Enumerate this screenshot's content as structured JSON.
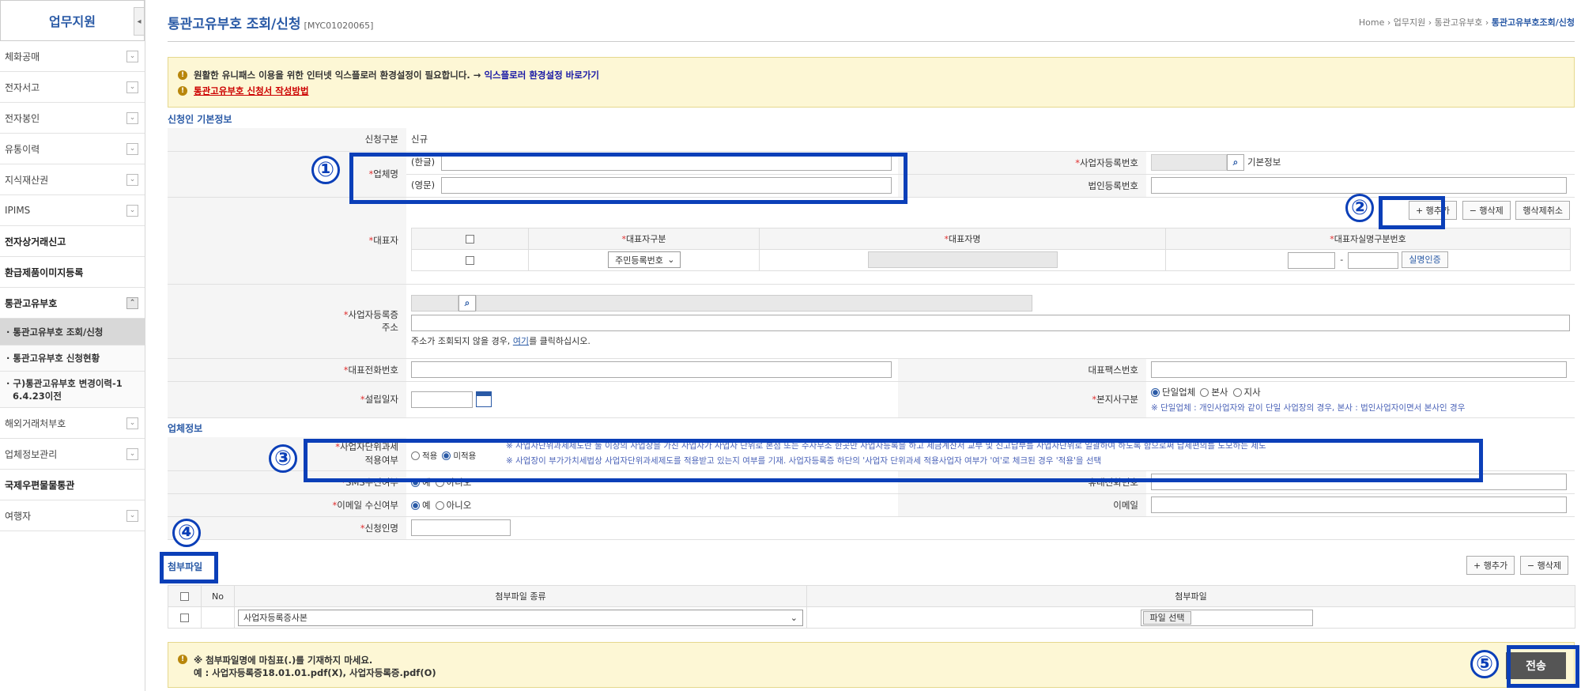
{
  "sidebar": {
    "title": "업무지원",
    "toggle": "◂",
    "items": [
      {
        "label": "체화공매"
      },
      {
        "label": "전자서고"
      },
      {
        "label": "전자봉인"
      },
      {
        "label": "유통이력"
      },
      {
        "label": "지식재산권"
      },
      {
        "label": "IPIMS"
      },
      {
        "label": "전자상거래신고"
      },
      {
        "label": "환급제품이미지등록"
      },
      {
        "label": "통관고유부호"
      }
    ],
    "sub_items": [
      {
        "label": "· 통관고유부호 조회/신청"
      },
      {
        "label": "· 통관고유부호 신청현황"
      },
      {
        "label_line1": "· 구)통관고유부호 변경이력-1",
        "label_line2": "6.4.23이전"
      }
    ],
    "items_after": [
      {
        "label": "해외거래처부호"
      },
      {
        "label": "업체정보관리"
      },
      {
        "label": "국제우편물물통관"
      },
      {
        "label": "여행자"
      }
    ]
  },
  "header": {
    "title": "통관고유부호 조회/신청",
    "code": "[MYC01020065]",
    "breadcrumb": [
      "Home",
      "업무지원",
      "통관고유부호",
      "통관고유부호조회/신청"
    ],
    "sep": "›"
  },
  "notice": {
    "line1_text": "원활한 유니패스 이용을 위한 인터넷 익스플로러 환경설정이 필요합니다. →",
    "line1_link": "익스플로러 환경설정 바로가기",
    "line2_link": "통관고유부호 신청서 작성방법"
  },
  "applicant": {
    "section_title": "신청인 기본정보",
    "apply_type_label": "신청구분",
    "apply_type_value": "신규",
    "company_name_label": "업체명",
    "company_kor_label": "(한글)",
    "company_eng_label": "(영문)",
    "biz_reg_no_label": "사업자등록번호",
    "basic_info": "기본정보",
    "corp_reg_no_label": "법인등록번호",
    "add_row": "+ 행추가",
    "delete_row": "− 행삭제",
    "cancel_delete": "행삭제취소",
    "rep_label": "대표자",
    "rep_col_type": "대표자구분",
    "rep_col_name": "대표자명",
    "rep_col_idno": "대표자실명구분번호",
    "rep_select_value": "주민등록번호",
    "id_dash": "-",
    "verify_button": "실명인증",
    "address_label_1": "사업자등록증",
    "address_label_2": "주소",
    "address_note_pre": "주소가 조회되지 않을 경우,",
    "address_note_link": "여기",
    "address_note_post": "를 클릭하십시오.",
    "phone_label": "대표전화번호",
    "fax_label": "대표팩스번호",
    "est_date_label": "설립일자",
    "hq_branch_label": "본지사구분",
    "hq_options": [
      "단일업체",
      "본사",
      "지사"
    ],
    "hq_note": "※ 단일업체 : 개인사업자와 같이 단일 사업장의 경우, 본사 : 법인사업자이면서 본사인 경우"
  },
  "company": {
    "section_title": "업체정보",
    "unit_tax_label_1": "사업자단위과세",
    "unit_tax_label_2": "적용여부",
    "unit_tax_options": [
      "적용",
      "미적용"
    ],
    "unit_tax_note1": "※ 사업자단위과세제도란 둘 이상의 사업장을 가진 사업자가 사업자 단위로 본점 또는 주사무소 한곳만 사업자등록을 하고 세금계산서 교부 및 신고납부를 사업자단위로 일괄하여 하도록 함으로써 납세편의를 도모하는 제도",
    "unit_tax_note2": "※ 사업장이 부가가치세법상 사업자단위과세제도를 적용받고 있는지 여부를 기재. 사업자등록증 하단의 '사업자 단위과세 적용사업자 여부가 '여'로 체크된 경우 '적용'을 선택",
    "sms_label": "SMS수신여부",
    "yes": "예",
    "no": "아니오",
    "mobile_label": "휴대전화번호",
    "email_recv_label": "이메일 수신여부",
    "email_label": "이메일",
    "applicant_name_label": "신청인명"
  },
  "attachments": {
    "section_title": "첨부파일",
    "add_row": "+ 행추가",
    "delete_row": "− 행삭제",
    "col_no": "No",
    "col_type": "첨부파일 종류",
    "col_file": "첨부파일",
    "row_type_value": "사업자등록증사본",
    "file_button": "파일 선택"
  },
  "footer_notice": {
    "line1": "※ 첨부파일명에 마침표(.)를 기재하지 마세요.",
    "line2": "예 : 사업자등록증18.01.01.pdf(X), 사업자등록증.pdf(O)",
    "submit": "전송"
  },
  "callouts": [
    "①",
    "②",
    "③",
    "④",
    "⑤"
  ],
  "colors": {
    "accent": "#2a5aa6",
    "highlight": "#0b3fb8",
    "required": "#e03030",
    "notice_bg": "#fdf7d5"
  }
}
